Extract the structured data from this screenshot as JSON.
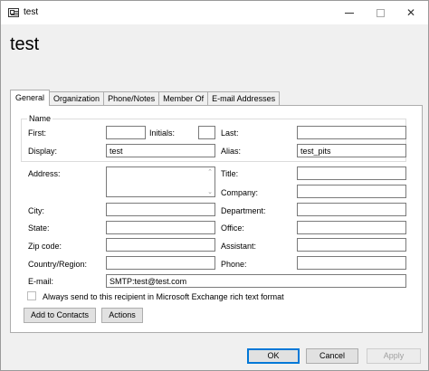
{
  "window": {
    "title": "test"
  },
  "header": {
    "title": "test"
  },
  "tabs": [
    {
      "label": "General",
      "active": true
    },
    {
      "label": "Organization",
      "active": false
    },
    {
      "label": "Phone/Notes",
      "active": false
    },
    {
      "label": "Member Of",
      "active": false
    },
    {
      "label": "E-mail Addresses",
      "active": false
    }
  ],
  "name_group": {
    "legend": "Name",
    "first_label": "First:",
    "first_value": "",
    "initials_label": "Initials:",
    "initials_value": "",
    "last_label": "Last:",
    "last_value": "",
    "display_label": "Display:",
    "display_value": "test",
    "alias_label": "Alias:",
    "alias_value": "test_pits"
  },
  "fields": {
    "address_label": "Address:",
    "address_value": "",
    "title_label": "Title:",
    "title_value": "",
    "company_label": "Company:",
    "company_value": "",
    "city_label": "City:",
    "city_value": "",
    "department_label": "Department:",
    "department_value": "",
    "state_label": "State:",
    "state_value": "",
    "office_label": "Office:",
    "office_value": "",
    "zip_label": "Zip code:",
    "zip_value": "",
    "assistant_label": "Assistant:",
    "assistant_value": "",
    "country_label": "Country/Region:",
    "country_value": "",
    "phone_label": "Phone:",
    "phone_value": "",
    "email_label": "E-mail:",
    "email_value": "SMTP:test@test.com"
  },
  "checkbox": {
    "label": "Always send to this recipient in Microsoft Exchange rich text format",
    "checked": false
  },
  "buttons": {
    "add_to_contacts": "Add to Contacts",
    "actions": "Actions",
    "ok": "OK",
    "cancel": "Cancel",
    "apply": "Apply"
  },
  "icons": {
    "minimize": "minimize-icon",
    "maximize": "maximize-icon",
    "close": "close-icon",
    "close_glyph": "✕",
    "scroll_up_glyph": "⌃",
    "scroll_down_glyph": "⌄"
  }
}
